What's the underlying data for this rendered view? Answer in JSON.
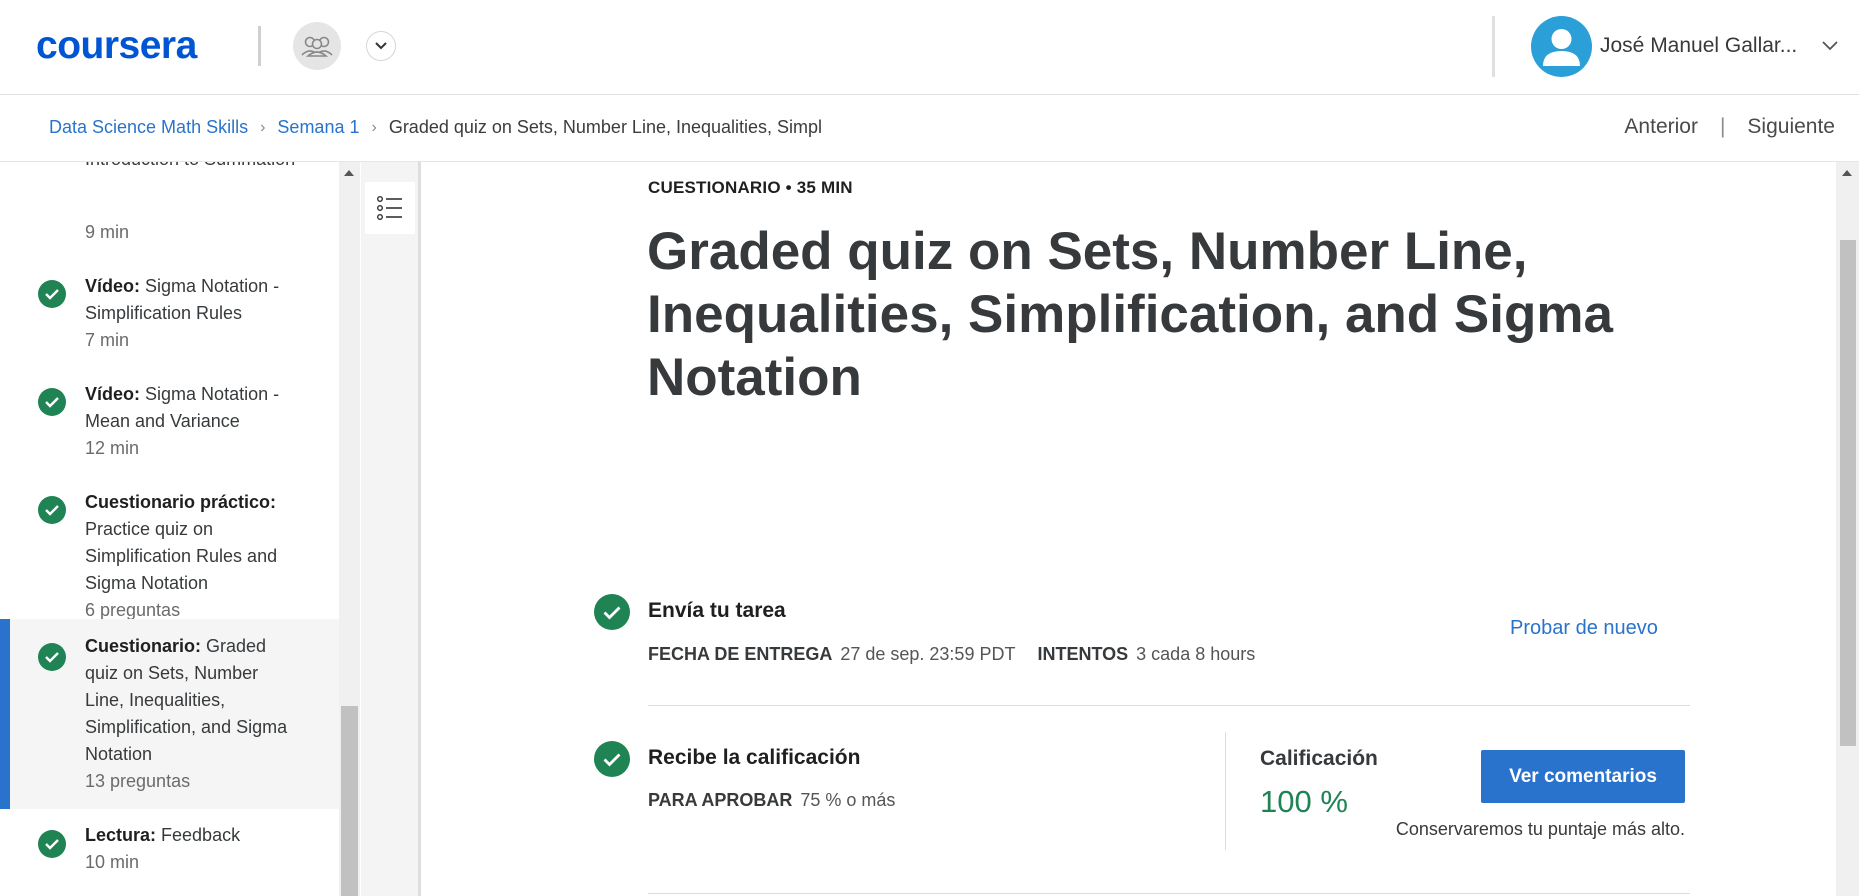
{
  "header": {
    "logo_text": "coursera",
    "user_name": "José Manuel Gallar...",
    "brand_color": "#0056D2",
    "avatar_color": "#2A9FD8"
  },
  "breadcrumb": {
    "items": [
      "Data Science Math Skills",
      "Semana 1"
    ],
    "current": "Graded quiz on Sets, Number Line, Inequalities, Simpl"
  },
  "nav": {
    "previous": "Anterior",
    "divider": "|",
    "next": "Siguiente"
  },
  "sidebar": {
    "items": [
      {
        "type": "",
        "title": "Introduction to Summation",
        "meta": "9 min",
        "completed": true
      },
      {
        "type": "Vídeo:",
        "title": "Sigma Notation - Simplification Rules",
        "meta": "7 min",
        "completed": true
      },
      {
        "type": "Vídeo:",
        "title": "Sigma Notation - Mean and Variance",
        "meta": "12 min",
        "completed": true
      },
      {
        "type": "Cuestionario práctico:",
        "title": "Practice quiz on Simplification Rules and Sigma Notation",
        "meta": "6 preguntas",
        "completed": true
      },
      {
        "type": "Cuestionario:",
        "title": "Graded quiz on Sets, Number Line, Inequalities, Simplification, and Sigma Notation",
        "meta": "13 preguntas",
        "completed": true,
        "active": true
      },
      {
        "type": "Lectura:",
        "title": "Feedback",
        "meta": "10 min",
        "completed": true
      }
    ]
  },
  "main": {
    "kicker": "CUESTIONARIO • 35 MIN",
    "title": "Graded quiz on Sets, Number Line, Inequalities, Simplification, and Sigma Notation",
    "submit": {
      "title": "Envía tu tarea",
      "due_label": "FECHA DE ENTREGA",
      "due_value": "27 de sep. 23:59 PDT",
      "attempts_label": "INTENTOS",
      "attempts_value": "3 cada 8 hours",
      "retry_link": "Probar de nuevo"
    },
    "grade": {
      "title": "Recibe la calificación",
      "pass_label": "PARA APROBAR",
      "pass_value": "75 % o más",
      "grade_label": "Calificación",
      "grade_value": "100 %",
      "feedback_button": "Ver comentarios",
      "keep_note": "Conservaremos tu puntaje más alto."
    },
    "success_color": "#1F8354",
    "link_color": "#2A73CC"
  }
}
